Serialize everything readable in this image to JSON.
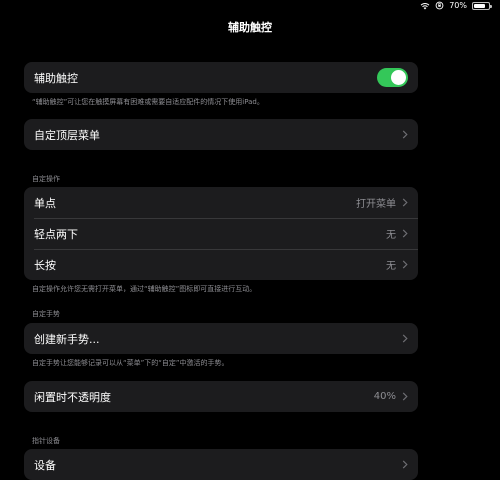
{
  "status_bar": {
    "battery": "70%",
    "icons": [
      "wifi-icon",
      "rotation-lock-icon",
      "battery-icon"
    ]
  },
  "page_title": "辅助触控",
  "main_toggle": {
    "label": "辅助触控",
    "on": true,
    "footnote": "“辅助触控”可让您在触摸屏幕有困难或需要自适应配件的情况下使用iPad。"
  },
  "custom_top_menu": {
    "label": "自定顶层菜单"
  },
  "custom_actions": {
    "header": "自定操作",
    "rows": [
      {
        "label": "单点",
        "value": "打开菜单"
      },
      {
        "label": "轻点两下",
        "value": "无"
      },
      {
        "label": "长按",
        "value": "无"
      }
    ],
    "footnote": "自定操作允许您无需打开菜单，通过“辅助触控”图标即可直接进行互动。"
  },
  "custom_gestures": {
    "header": "自定手势",
    "create_label": "创建新手势...",
    "footnote": "自定手势让您能够记录可以从“菜单”下的“自定”中激活的手势。"
  },
  "idle_opacity": {
    "label": "闲置时不透明度",
    "value": "40%"
  },
  "pointer_devices": {
    "header": "指针设备",
    "devices_label": "设备"
  },
  "colors": {
    "background": "#000000",
    "card": "#1c1c1e",
    "toggle_on": "#34c759",
    "secondary_text": "#8e8e93"
  }
}
